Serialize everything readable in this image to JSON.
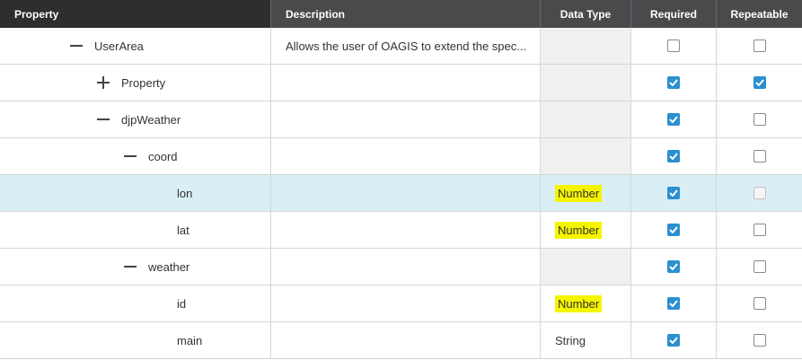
{
  "columns": {
    "property": "Property",
    "description": "Description",
    "data_type": "Data Type",
    "required": "Required",
    "repeatable": "Repeatable"
  },
  "rows": [
    {
      "name": "UserArea",
      "toggle": "minus",
      "description": "Allows the user of OAGIS to extend the spec...",
      "data_type": "",
      "highlight": false,
      "required": false,
      "repeatable": false
    },
    {
      "name": "Property",
      "toggle": "plus",
      "description": "",
      "data_type": "",
      "highlight": false,
      "required": true,
      "repeatable": true
    },
    {
      "name": "djpWeather",
      "toggle": "minus",
      "description": "",
      "data_type": "",
      "highlight": false,
      "required": true,
      "repeatable": false
    },
    {
      "name": "coord",
      "toggle": "minus",
      "description": "",
      "data_type": "",
      "highlight": false,
      "required": true,
      "repeatable": false
    },
    {
      "name": "lon",
      "toggle": "none",
      "description": "",
      "data_type": "Number",
      "highlight": true,
      "required": true,
      "repeatable": false,
      "selected": true,
      "repeatable_disabled": true
    },
    {
      "name": "lat",
      "toggle": "none",
      "description": "",
      "data_type": "Number",
      "highlight": true,
      "required": true,
      "repeatable": false
    },
    {
      "name": "weather",
      "toggle": "minus",
      "description": "",
      "data_type": "",
      "highlight": false,
      "required": true,
      "repeatable": false
    },
    {
      "name": "id",
      "toggle": "none",
      "description": "",
      "data_type": "Number",
      "highlight": true,
      "required": true,
      "repeatable": false
    },
    {
      "name": "main",
      "toggle": "none",
      "description": "",
      "data_type": "String",
      "highlight": false,
      "required": true,
      "repeatable": false
    }
  ],
  "colors": {
    "header_bg": "#4a4a4d",
    "header_property_bg": "#2e2e30",
    "selected_row": "#daeef5",
    "checkbox_checked": "#2b8fd0",
    "highlight": "#f5f500",
    "empty_type_cell": "#f0f0f0"
  }
}
